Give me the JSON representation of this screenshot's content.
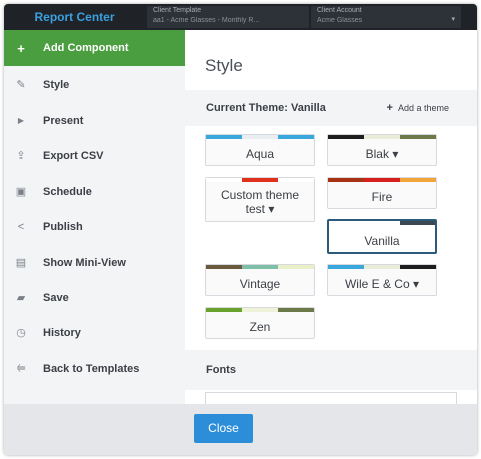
{
  "topbar": {
    "brand": "Report Center",
    "client_template": {
      "label": "Client Template",
      "value": "aa1 - Acme Glasses - Monthly R..."
    },
    "client_account": {
      "label": "Client Account",
      "value": "Acme Glasses",
      "caret": "▾"
    }
  },
  "sidebar": {
    "items": [
      {
        "label": "Add Component",
        "icon": "+"
      },
      {
        "label": "Style",
        "icon": "✎"
      },
      {
        "label": "Present",
        "icon": "▶"
      },
      {
        "label": "Export CSV",
        "icon": "⇪"
      },
      {
        "label": "Schedule",
        "icon": "▣"
      },
      {
        "label": "Publish",
        "icon": "<"
      },
      {
        "label": "Show Mini-View",
        "icon": "▤"
      },
      {
        "label": "Save",
        "icon": "▰"
      },
      {
        "label": "History",
        "icon": "◷"
      },
      {
        "label": "Back to Templates",
        "icon": "⥢"
      }
    ]
  },
  "panel": {
    "title": "Style",
    "current_theme_label": "Current Theme:",
    "current_theme_value": "Vanilla",
    "add_theme_label": "Add a theme",
    "fonts_label": "Fonts"
  },
  "themes": [
    {
      "name": "Aqua",
      "colors": [
        "#3aa7dd",
        "#e9eef2",
        "#3aa7dd"
      ]
    },
    {
      "name": "Blak ▾",
      "colors": [
        "#1e1e1e",
        "#e8ecd8",
        "#6b7a48"
      ]
    },
    {
      "name": "Custom theme test ▾",
      "colors": [
        "#ffffff",
        "#e0311c",
        "#ffffff"
      ]
    },
    {
      "name": "Fire",
      "colors": [
        "#a83314",
        "#d6201c",
        "#f0a43a"
      ]
    },
    {
      "name": "Vanilla",
      "colors": [
        "#ffffff",
        "#ffffff",
        "#3b4a52"
      ]
    },
    {
      "name": "Vintage",
      "colors": [
        "#6b5a3e",
        "#7fbfa8",
        "#e8efc9"
      ]
    },
    {
      "name": "Wile E & Co ▾",
      "colors": [
        "#3aa7dd",
        "#e8ecd8",
        "#1e1e1e"
      ]
    },
    {
      "name": "Zen",
      "colors": [
        "#6aa22e",
        "#eef2d8",
        "#6b7a48"
      ]
    }
  ],
  "footer": {
    "close_label": "Close"
  },
  "colors": {
    "accent_green": "#4b9e3f",
    "close_blue": "#2c8ed8",
    "topbar": "#1f2328",
    "brand_blue": "#3aa0e0"
  }
}
